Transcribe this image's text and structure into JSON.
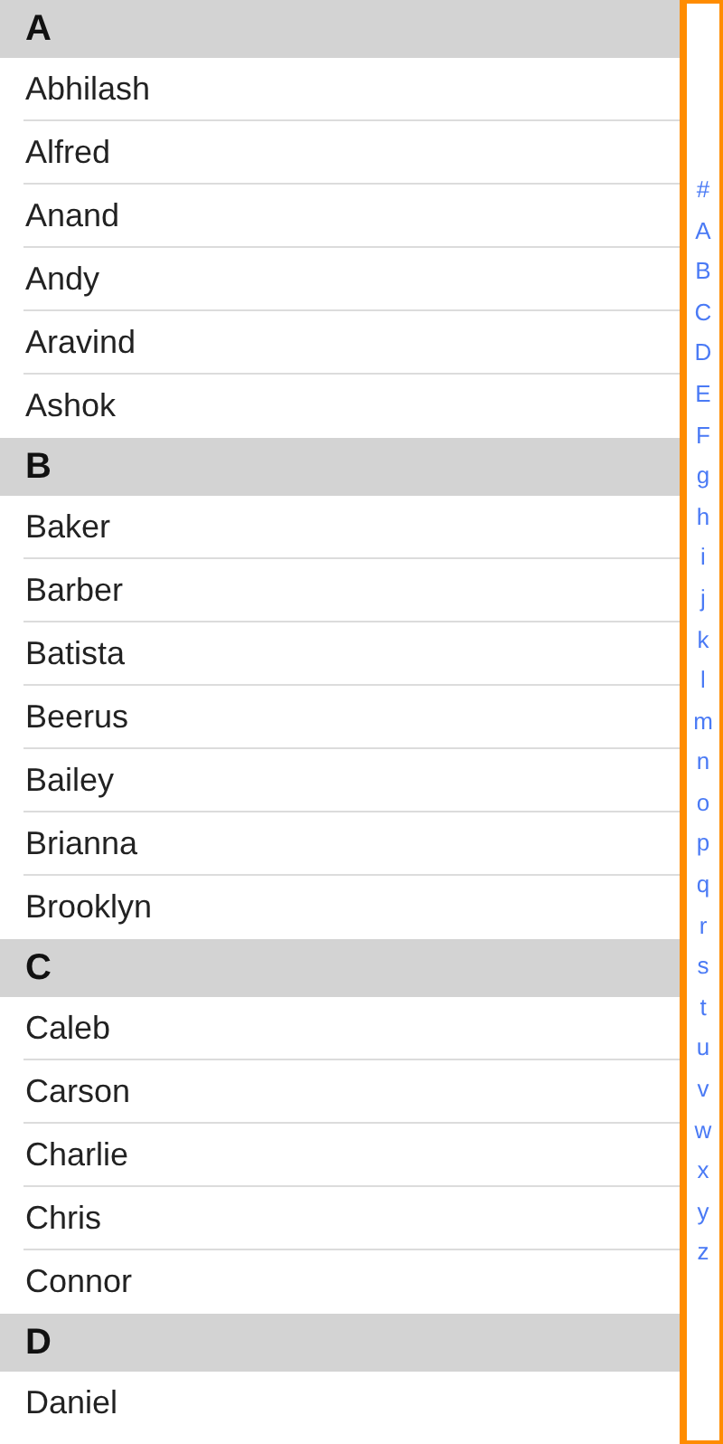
{
  "sections": [
    {
      "letter": "A",
      "names": [
        "Abhilash",
        "Alfred",
        "Anand",
        "Andy",
        "Aravind",
        "Ashok"
      ]
    },
    {
      "letter": "B",
      "names": [
        "Baker",
        "Barber",
        "Batista",
        "Beerus",
        "Bailey",
        "Brianna",
        "Brooklyn"
      ]
    },
    {
      "letter": "C",
      "names": [
        "Caleb",
        "Carson",
        "Charlie",
        "Chris",
        "Connor"
      ]
    },
    {
      "letter": "D",
      "names": [
        "Daniel"
      ]
    }
  ],
  "index": [
    "#",
    "A",
    "B",
    "C",
    "D",
    "E",
    "F",
    "g",
    "h",
    "i",
    "j",
    "k",
    "l",
    "m",
    "n",
    "o",
    "p",
    "q",
    "r",
    "s",
    "t",
    "u",
    "v",
    "w",
    "x",
    "y",
    "z"
  ]
}
